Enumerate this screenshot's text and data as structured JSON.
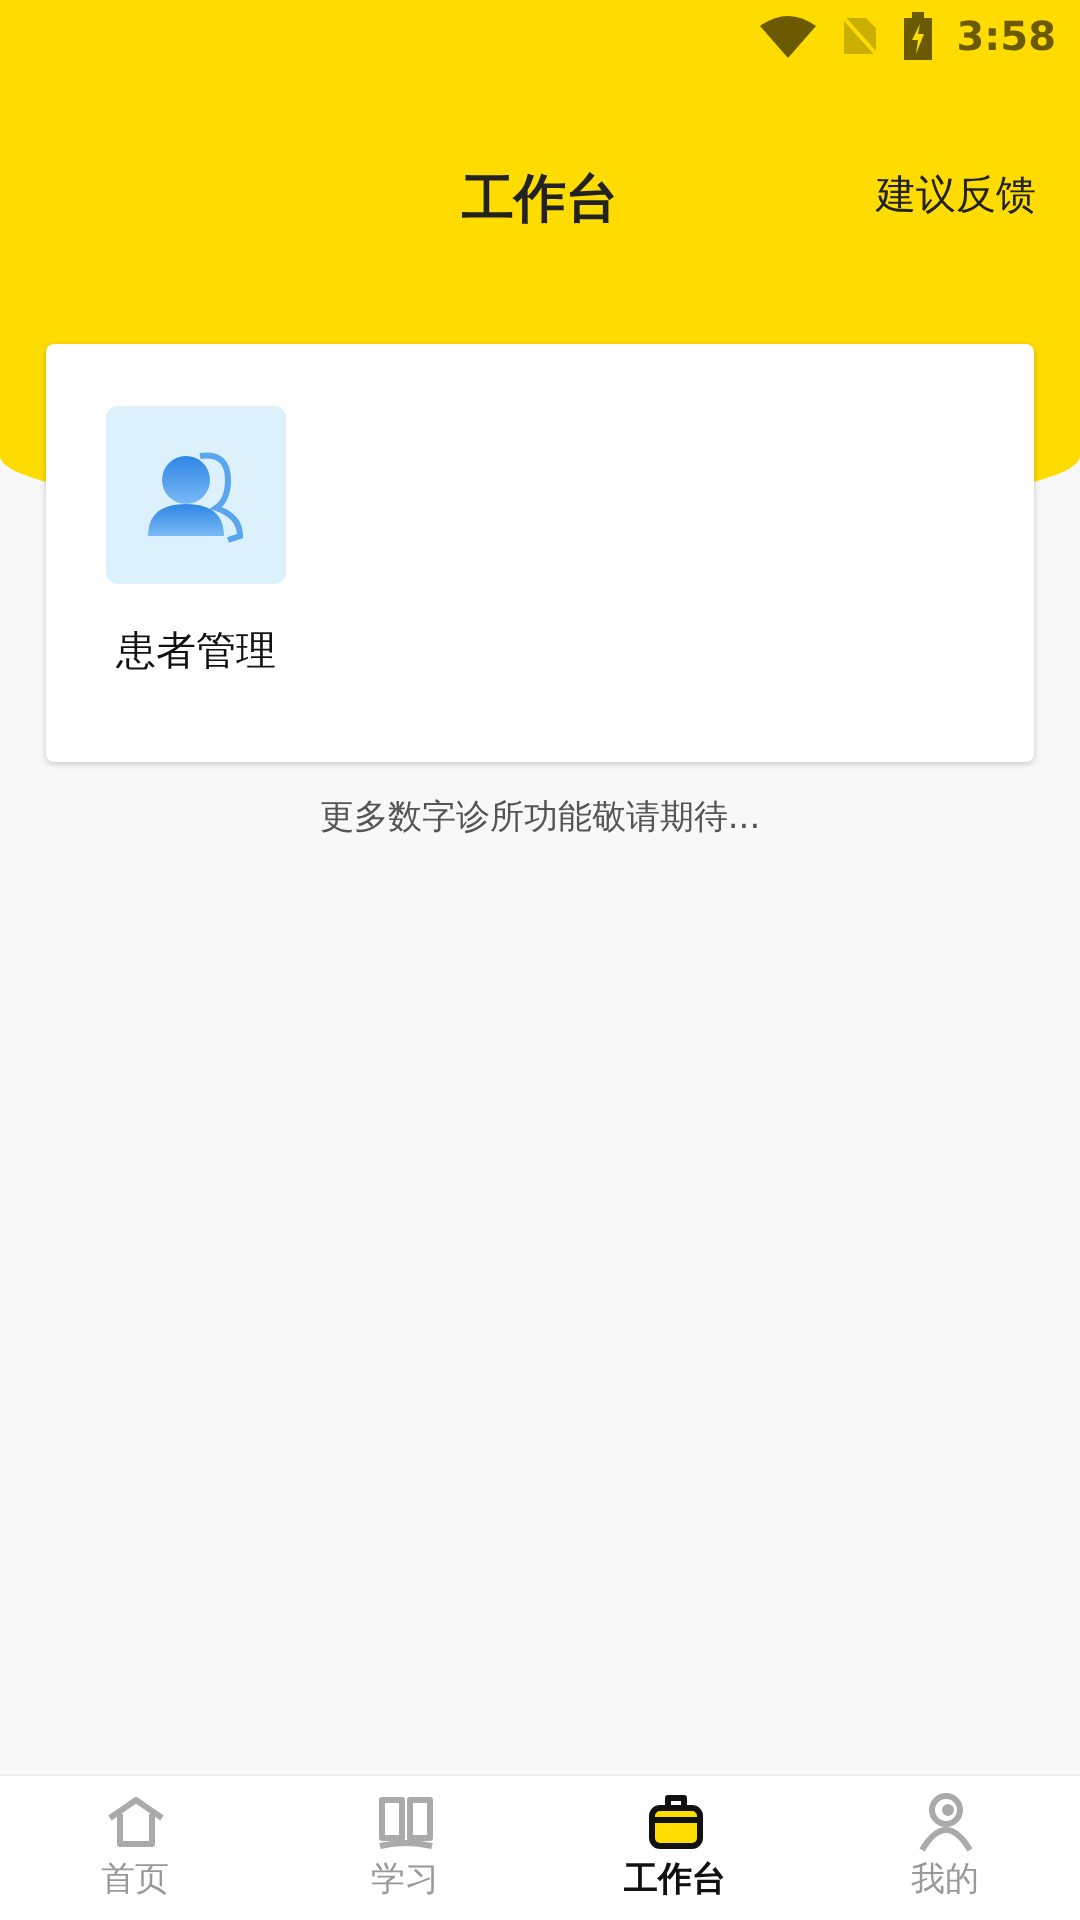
{
  "status_bar": {
    "time": "3:58"
  },
  "header": {
    "title": "工作台",
    "action": "建议反馈"
  },
  "tools": [
    {
      "label": "患者管理"
    }
  ],
  "note": "更多数字诊所功能敬请期待...",
  "tabs": [
    {
      "label": "首页",
      "kind": "home",
      "selected": false
    },
    {
      "label": "学习",
      "kind": "book",
      "selected": false
    },
    {
      "label": "工作台",
      "kind": "briefcase",
      "selected": true
    },
    {
      "label": "我的",
      "kind": "person",
      "selected": false
    }
  ]
}
